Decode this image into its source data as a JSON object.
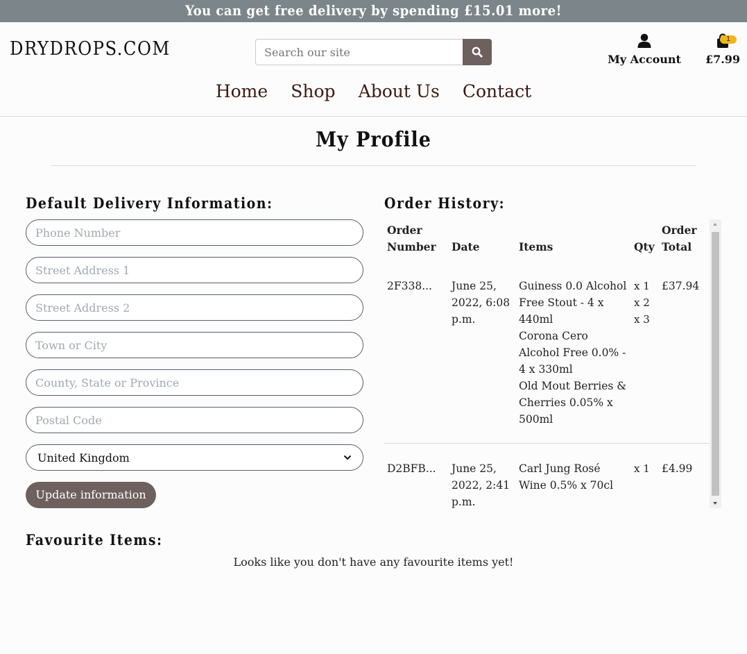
{
  "banner": {
    "text": "You can get free delivery by spending £15.01 more!"
  },
  "header": {
    "logo": "DRYDROPS.COM",
    "search_placeholder": "Search our site",
    "search_icon": "search-icon",
    "account_label": "My Account",
    "account_icon": "user-icon",
    "bag_icon": "shopping-bag-icon",
    "bag_count": "1",
    "bag_total": "£7.99"
  },
  "nav": {
    "items": [
      "Home",
      "Shop",
      "About Us",
      "Contact"
    ]
  },
  "page": {
    "title": "My Profile"
  },
  "delivery": {
    "heading": "Default Delivery Information:",
    "fields": [
      {
        "placeholder": "Phone Number",
        "value": ""
      },
      {
        "placeholder": "Street Address 1",
        "value": ""
      },
      {
        "placeholder": "Street Address 2",
        "value": ""
      },
      {
        "placeholder": "Town or City",
        "value": ""
      },
      {
        "placeholder": "County, State or Province",
        "value": ""
      },
      {
        "placeholder": "Postal Code",
        "value": ""
      }
    ],
    "country": "United Kingdom",
    "update_label": "Update information"
  },
  "orders": {
    "heading": "Order History:",
    "columns": {
      "number": "Order Number",
      "date": "Date",
      "items": "Items",
      "qty": "Qty",
      "total": "Order Total"
    },
    "rows": [
      {
        "number": "2F338...",
        "date": "June 25, 2022, 6:08 p.m.",
        "items": [
          "Guiness 0.0 Alcohol Free Stout - 4 x 440ml",
          "Corona Cero Alcohol Free 0.0% - 4 x 330ml",
          "Old Mout Berries & Cherries 0.05% x 500ml"
        ],
        "qty": [
          "x 1",
          "x 2",
          "x 3"
        ],
        "total": "£37.94"
      },
      {
        "number": "D2BFB...",
        "date": "June 25, 2022, 2:41 p.m.",
        "items": [
          "Carl Jung Rosé Wine 0.5% x 70cl"
        ],
        "qty": [
          "x 1"
        ],
        "total": "£4.99"
      }
    ]
  },
  "favourites": {
    "heading": "Favourite Items:",
    "empty_text": "Looks like you don't have any favourite items yet!"
  },
  "colors": {
    "banner": "#7c868a",
    "button": "#6e605d",
    "nav_text": "#3a1a10",
    "badge": "#f1b51c"
  }
}
